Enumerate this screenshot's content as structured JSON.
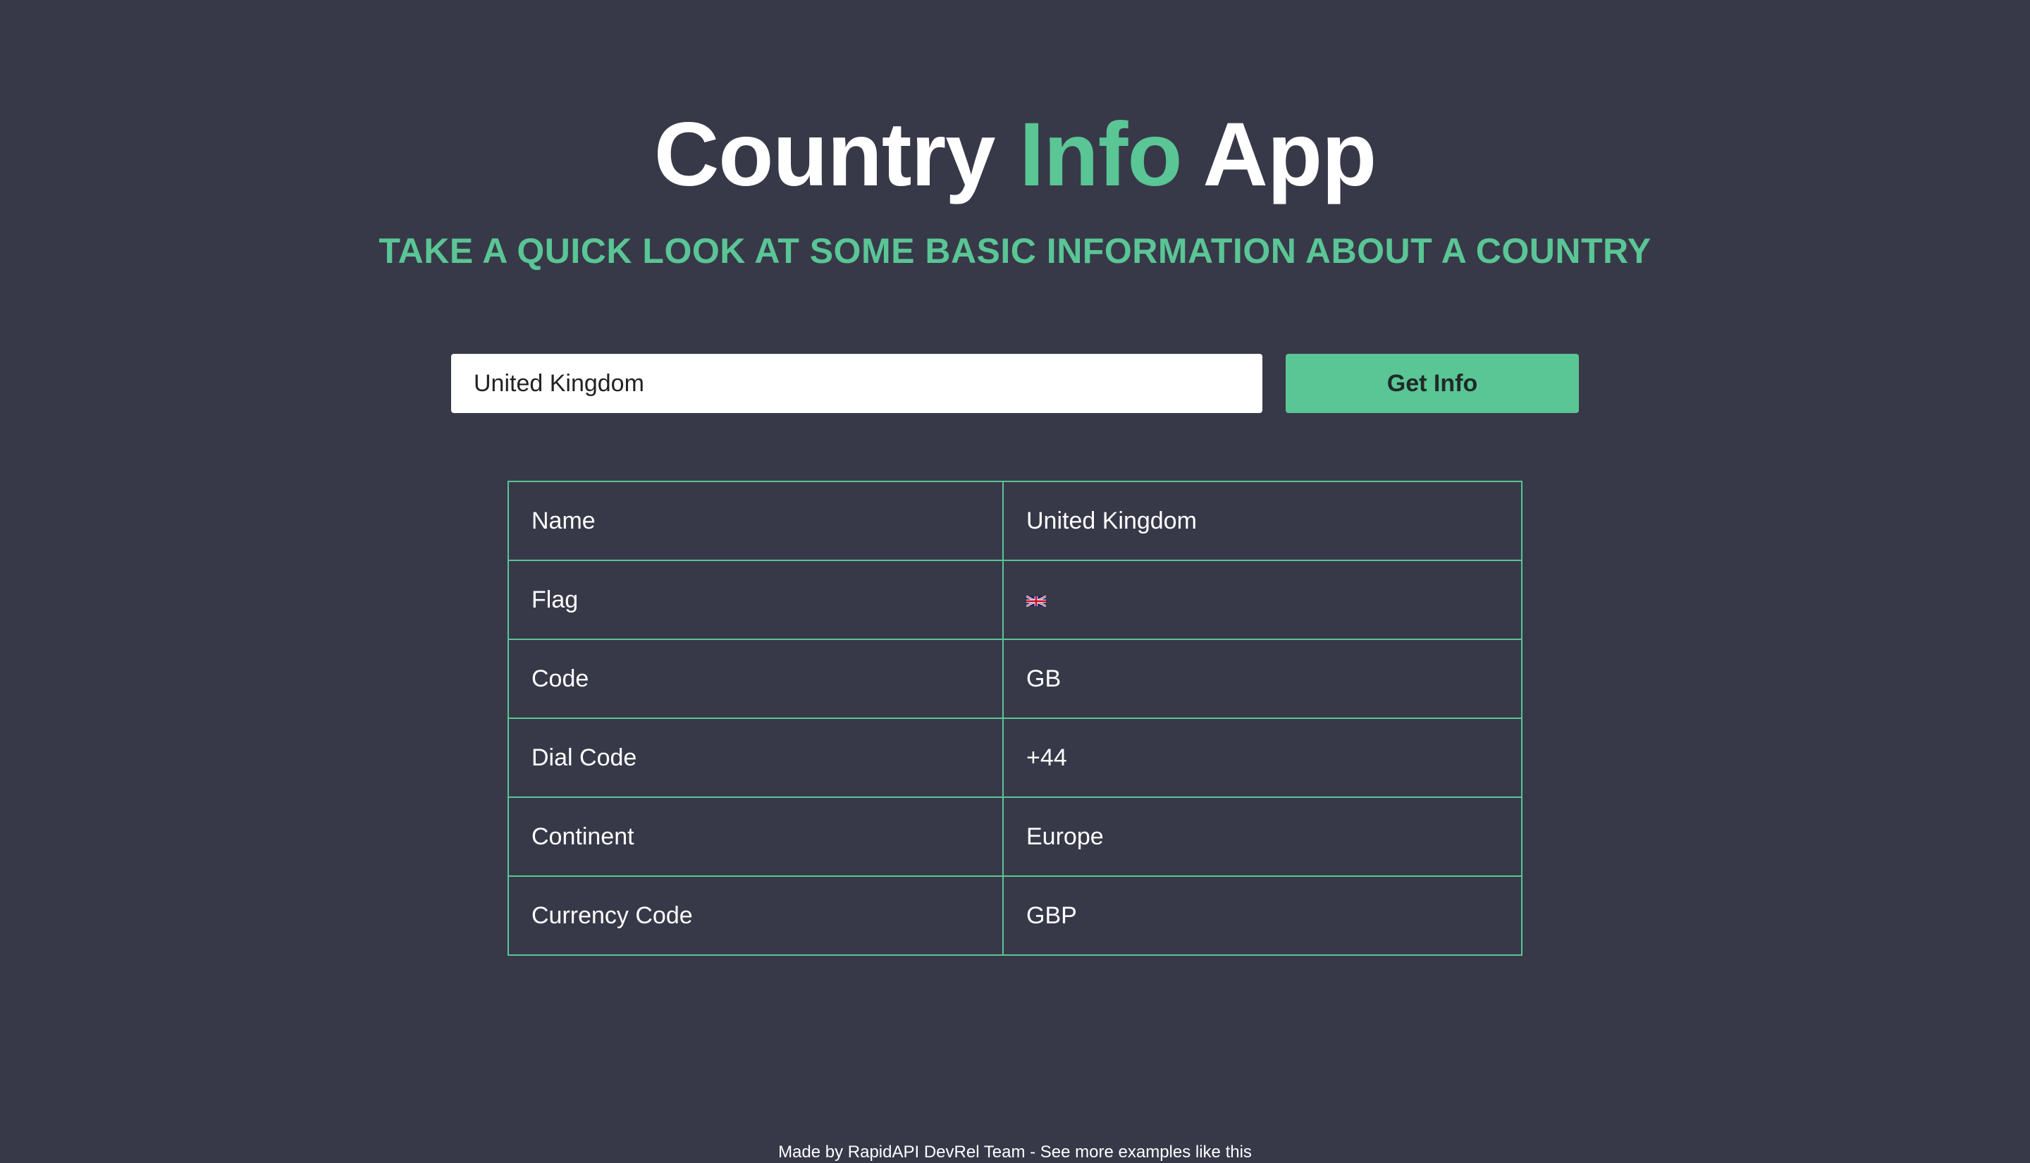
{
  "header": {
    "title_part1": "Country ",
    "title_accent": "Info",
    "title_part2": " App",
    "subtitle": "TAKE A QUICK LOOK AT SOME BASIC INFORMATION ABOUT A COUNTRY"
  },
  "search": {
    "value": "United Kingdom",
    "button_label": "Get Info"
  },
  "table": {
    "rows": [
      {
        "key": "Name",
        "value": "United Kingdom"
      },
      {
        "key": "Flag",
        "value": "🇬🇧",
        "icon": "uk-flag-icon"
      },
      {
        "key": "Code",
        "value": "GB"
      },
      {
        "key": "Dial Code",
        "value": "+44"
      },
      {
        "key": "Continent",
        "value": "Europe"
      },
      {
        "key": "Currency Code",
        "value": "GBP"
      }
    ]
  },
  "footer": {
    "made_by": "Made by RapidAPI DevRel Team",
    "separator": " - ",
    "more_link": "See more examples like this"
  },
  "colors": {
    "background": "#373948",
    "accent": "#5ac595",
    "text": "#ffffff"
  }
}
